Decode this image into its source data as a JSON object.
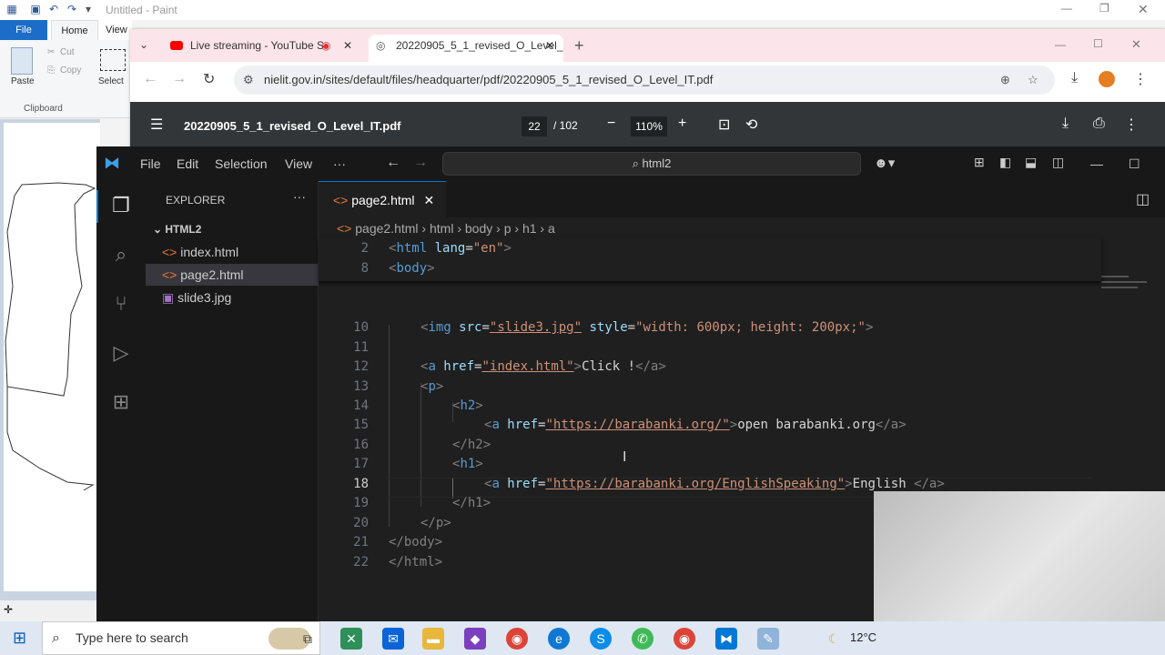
{
  "paint": {
    "title": "Untitled - Paint",
    "tabs": {
      "file": "File",
      "home": "Home",
      "view": "View"
    },
    "cut": "Cut",
    "copy": "Copy",
    "paste": "Paste",
    "select": "Select",
    "clipboard": "Clipboard"
  },
  "chrome": {
    "tab1": "Live streaming - YouTube S",
    "tab2": "20220905_5_1_revised_O_Level_",
    "url": "nielit.gov.in/sites/default/files/headquarter/pdf/20220905_5_1_revised_O_Level_IT.pdf",
    "pdf_title": "20220905_5_1_revised_O_Level_IT.pdf",
    "page": "22",
    "total": "/ 102",
    "zoom": "110%"
  },
  "vscode": {
    "menu": [
      "File",
      "Edit",
      "Selection",
      "View"
    ],
    "search": "html2",
    "explorer": "EXPLORER",
    "folder": "HTML2",
    "files": [
      "index.html",
      "page2.html",
      "slide3.jpg"
    ],
    "tab": "page2.html",
    "breadcrumb": [
      "page2.html",
      "html",
      "body",
      "p",
      "h1",
      "a"
    ]
  },
  "code": {
    "l2": {
      "n": "2",
      "t1": "<",
      "tag": "html",
      "attr": " lang",
      "eq": "=",
      "val": "\"en\"",
      "t2": ">"
    },
    "l8": {
      "n": "8",
      "t1": "<",
      "tag": "body",
      "t2": ">"
    },
    "l10": {
      "n": "10",
      "t1": "<",
      "tag": "img",
      "a1": " src",
      "v1": "\"slide3.jpg\"",
      "a2": " style",
      "v2": "\"width: 600px; height: 200px;\"",
      "t2": ">"
    },
    "l11": {
      "n": "11"
    },
    "l12": {
      "n": "12",
      "t1": "<",
      "tag": "a",
      "a1": " href",
      "v1": "\"index.html\"",
      "t2": ">",
      "text": "Click !",
      "close": "</a>"
    },
    "l13": {
      "n": "13",
      "t1": "<",
      "tag": "p",
      "t2": ">"
    },
    "l14": {
      "n": "14",
      "t1": "<",
      "tag": "h2",
      "t2": ">"
    },
    "l15": {
      "n": "15",
      "t1": "<",
      "tag": "a",
      "a1": " href",
      "v1": "\"https://barabanki.org/\"",
      "t2": ">",
      "text": "open barabanki.org",
      "close": "</a>"
    },
    "l16": {
      "n": "16",
      "tag": "</h2>"
    },
    "l17": {
      "n": "17",
      "t1": "<",
      "tag": "h1",
      "t2": ">"
    },
    "l18": {
      "n": "18",
      "t1": "<",
      "tag": "a",
      "a1": " href",
      "v1": "\"https://barabanki.org/EnglishSpeaking\"",
      "t2": ">",
      "text": "English ",
      "close": "</a>"
    },
    "l19": {
      "n": "19",
      "tag": "</h1>"
    },
    "l20": {
      "n": "20",
      "tag": "</p>"
    },
    "l21": {
      "n": "21",
      "tag": "</body>"
    },
    "l22": {
      "n": "22",
      "tag": "</html>"
    }
  },
  "taskbar": {
    "search": "Type here to search",
    "temp": "12°C"
  }
}
